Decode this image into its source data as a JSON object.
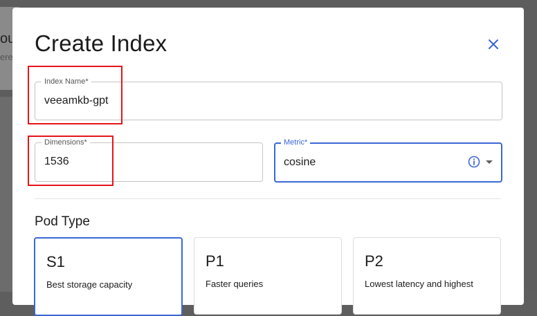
{
  "background": {
    "title_fragment": "ou",
    "subtitle_fragment": "ere"
  },
  "modal": {
    "title": "Create Index",
    "close_icon": "close-icon"
  },
  "form": {
    "index_name": {
      "label": "Index Name",
      "required_mark": "*",
      "value": "veeamkb-gpt"
    },
    "dimensions": {
      "label": "Dimensions",
      "required_mark": "*",
      "value": "1536"
    },
    "metric": {
      "label": "Metric",
      "required_mark": "*",
      "value": "cosine",
      "icons": [
        "info-icon",
        "dropdown-caret-icon"
      ]
    }
  },
  "pod_type": {
    "heading": "Pod Type",
    "options": [
      {
        "name": "S1",
        "description": "Best storage capacity",
        "selected": true
      },
      {
        "name": "P1",
        "description": "Faster queries",
        "selected": false
      },
      {
        "name": "P2",
        "description": "Lowest latency and highest",
        "selected": false
      }
    ]
  },
  "colors": {
    "accent": "#3a67d6",
    "highlight": "#e5141a"
  }
}
